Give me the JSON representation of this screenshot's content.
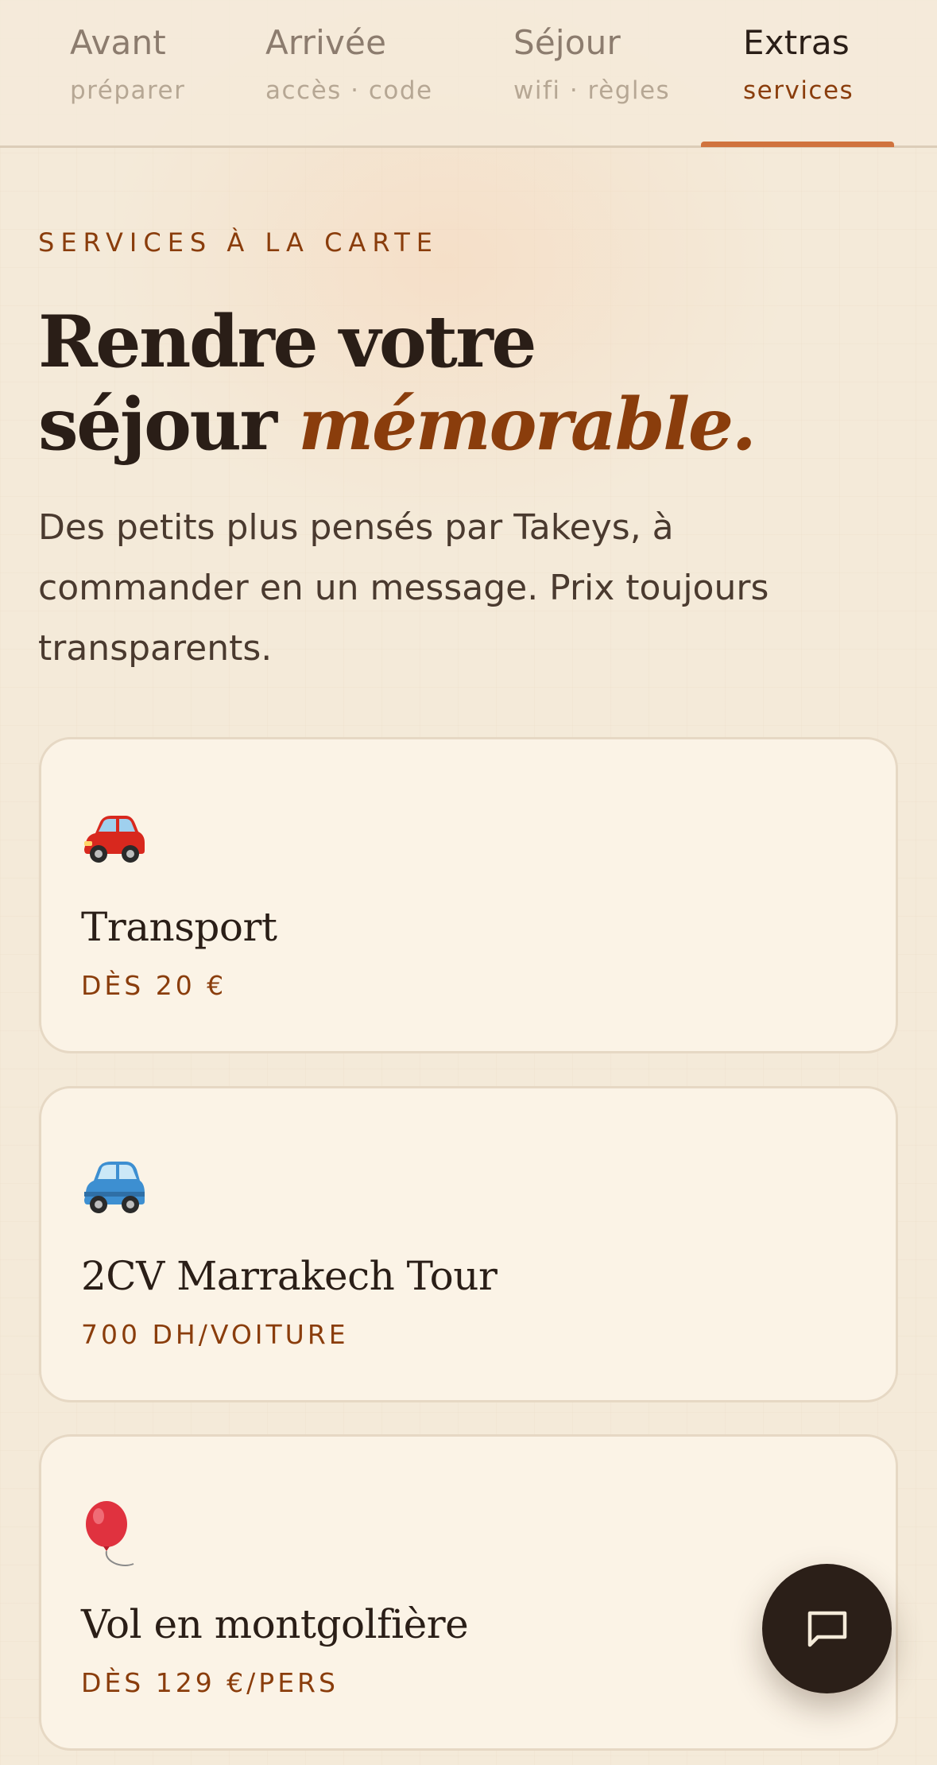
{
  "tabs": [
    {
      "title": "Avant",
      "subtitle": "préparer",
      "active": false
    },
    {
      "title": "Arrivée",
      "subtitle": "accès · code",
      "active": false
    },
    {
      "title": "Séjour",
      "subtitle": "wifi · règles",
      "active": false
    },
    {
      "title": "Extras",
      "subtitle": "services",
      "active": true
    }
  ],
  "hero": {
    "eyebrow": "SERVICES À LA CARTE",
    "headline_line1": "Rendre votre",
    "headline_line2_plain": "séjour ",
    "headline_accent": "mémorable.",
    "intro": "Des petits plus pensés par Takeys, à commander en un message. Prix toujours transparents."
  },
  "services": [
    {
      "icon": "red-car-icon",
      "title": "Transport",
      "price": "DÈS 20 €"
    },
    {
      "icon": "blue-car-icon",
      "title": "2CV Marrakech Tour",
      "price": "700 DH/VOITURE"
    },
    {
      "icon": "balloon-icon",
      "title": "Vol en montgolfière",
      "price": "DÈS 129 €/PERS"
    }
  ],
  "chat_button": {
    "icon": "chat-bubble-icon"
  },
  "colors": {
    "background": "#f4ead9",
    "accent": "#8a3d0c",
    "active_indicator": "#d0733e",
    "card_background": "#fbf3e6",
    "fab": "#2b1f18"
  }
}
